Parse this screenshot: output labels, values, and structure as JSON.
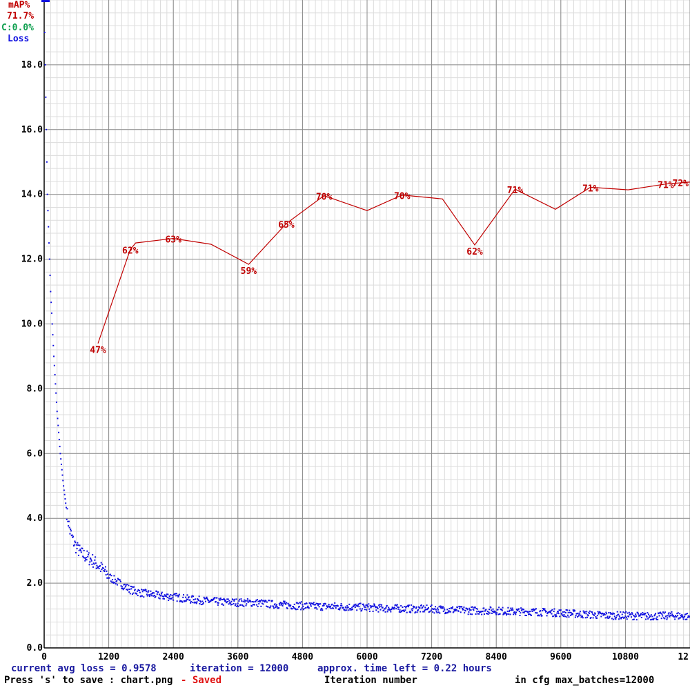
{
  "legend": {
    "map_title": "mAP%",
    "map_value": "71.7%",
    "c_value": "C:0.0%",
    "loss_title": "Loss",
    "map_color": "#c00000",
    "c_color": "#10a050",
    "loss_color": "#1010e0"
  },
  "footer": {
    "avg_loss": "current avg loss = 0.9578",
    "iteration": "iteration = 12000",
    "time_left": "approx. time left = 0.22 hours",
    "save_hint": "Press 's' to save : chart.png",
    "saved": "- Saved",
    "xlabel": "Iteration number",
    "max_batches": "in cfg max_batches=12000"
  },
  "chart_data": {
    "type": "line",
    "title": "",
    "xlabel": "Iteration number",
    "ylabel": "",
    "xlim": [
      0,
      12000
    ],
    "ylim": [
      0,
      20
    ],
    "grid": true,
    "legend_position": "top-left",
    "x_ticks": [
      {
        "value": 0,
        "label": "0"
      },
      {
        "value": 1200,
        "label": "1200"
      },
      {
        "value": 2400,
        "label": "2400"
      },
      {
        "value": 3600,
        "label": "3600"
      },
      {
        "value": 4800,
        "label": "4800"
      },
      {
        "value": 6000,
        "label": "6000"
      },
      {
        "value": 7200,
        "label": "7200"
      },
      {
        "value": 8400,
        "label": "8400"
      },
      {
        "value": 9600,
        "label": "9600"
      },
      {
        "value": 10800,
        "label": "10800"
      },
      {
        "value": 12000,
        "label": "12"
      }
    ],
    "y_ticks": [
      {
        "value": 0,
        "label": "0.0"
      },
      {
        "value": 2,
        "label": "2.0"
      },
      {
        "value": 4,
        "label": "4.0"
      },
      {
        "value": 6,
        "label": "6.0"
      },
      {
        "value": 8,
        "label": "8.0"
      },
      {
        "value": 10,
        "label": "10.0"
      },
      {
        "value": 12,
        "label": "12.0"
      },
      {
        "value": 14,
        "label": "14.0"
      },
      {
        "value": 16,
        "label": "16.0"
      },
      {
        "value": 18,
        "label": "18.0"
      }
    ],
    "series": [
      {
        "name": "mAP%",
        "color": "#c00000",
        "x": [
          1000,
          1600,
          1700,
          2400,
          3100,
          3800,
          4500,
          5200,
          6000,
          6650,
          7400,
          8000,
          8750,
          9500,
          10150,
          10850,
          11550,
          12000
        ],
        "y": [
          47,
          61.5,
          62.5,
          63.2,
          62.3,
          59.2,
          65.5,
          69.8,
          67.5,
          69.9,
          69.3,
          62.2,
          70.8,
          67.7,
          71.1,
          70.7,
          71.6,
          71.9
        ],
        "labels": [
          {
            "index": 0,
            "text": "47%"
          },
          {
            "index": 1,
            "text": "62%"
          },
          {
            "index": 3,
            "text": "63%"
          },
          {
            "index": 5,
            "text": "59%"
          },
          {
            "index": 6,
            "text": "65%"
          },
          {
            "index": 7,
            "text": "70%"
          },
          {
            "index": 9,
            "text": "70%"
          },
          {
            "index": 11,
            "text": "62%"
          },
          {
            "index": 12,
            "text": "71%"
          },
          {
            "index": 14,
            "text": "71%"
          },
          {
            "index": 16,
            "text": "71%"
          },
          {
            "index": 17,
            "text": "72%"
          }
        ]
      },
      {
        "name": "Loss",
        "color": "#1010e0",
        "x": [
          0,
          60,
          120,
          180,
          240,
          300,
          360,
          420,
          480,
          540,
          600,
          700,
          800,
          900,
          1000,
          1100,
          1200,
          1400,
          1600,
          1800,
          2000,
          2200,
          2400,
          2700,
          3000,
          3300,
          3600,
          3900,
          4200,
          4500,
          4800,
          5100,
          5400,
          5700,
          6000,
          6300,
          6600,
          6900,
          7200,
          7500,
          7800,
          8100,
          8400,
          8700,
          9000,
          9300,
          9600,
          9900,
          10200,
          10500,
          10800,
          11100,
          11400,
          11700,
          12000
        ],
        "y": [
          20.0,
          14.0,
          11.0,
          9.0,
          7.3,
          6.0,
          5.0,
          4.2,
          3.6,
          3.3,
          3.1,
          2.9,
          2.8,
          2.7,
          2.55,
          2.4,
          2.2,
          2.0,
          1.8,
          1.7,
          1.65,
          1.6,
          1.58,
          1.5,
          1.45,
          1.42,
          1.4,
          1.4,
          1.35,
          1.32,
          1.3,
          1.28,
          1.28,
          1.26,
          1.25,
          1.22,
          1.22,
          1.2,
          1.2,
          1.18,
          1.16,
          1.15,
          1.15,
          1.12,
          1.12,
          1.1,
          1.08,
          1.05,
          1.02,
          1.0,
          1.0,
          0.98,
          0.98,
          1.0,
          0.96
        ]
      }
    ]
  }
}
